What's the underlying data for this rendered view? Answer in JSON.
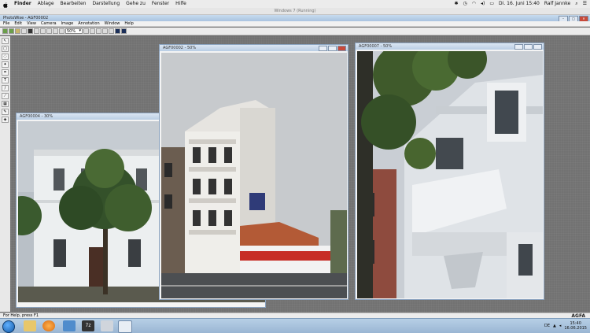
{
  "mac_menubar": {
    "app": "Finder",
    "menus": [
      "Ablage",
      "Bearbeiten",
      "Darstellung",
      "Gehe zu",
      "Fenster",
      "Hilfe"
    ],
    "datetime": "Di. 16. Juni  15:40",
    "user": "Ralf Jannke"
  },
  "vm_title": "Windows 7 (Running)",
  "app_window": {
    "title": "PhotoWise - AGF00002",
    "menus": [
      "File",
      "Edit",
      "View",
      "Camera",
      "Image",
      "Annotation",
      "Window",
      "Help"
    ],
    "zoom": "50%"
  },
  "image_windows": [
    {
      "title": "AGF00004 - 30%"
    },
    {
      "title": "AGF00002 - 50%"
    },
    {
      "title": "AGF00007 - 50%"
    }
  ],
  "status": {
    "text": "For Help, press F1",
    "brand": "AGFA"
  },
  "taskbar": {
    "time": "15:40",
    "date": "16.06.2015"
  }
}
